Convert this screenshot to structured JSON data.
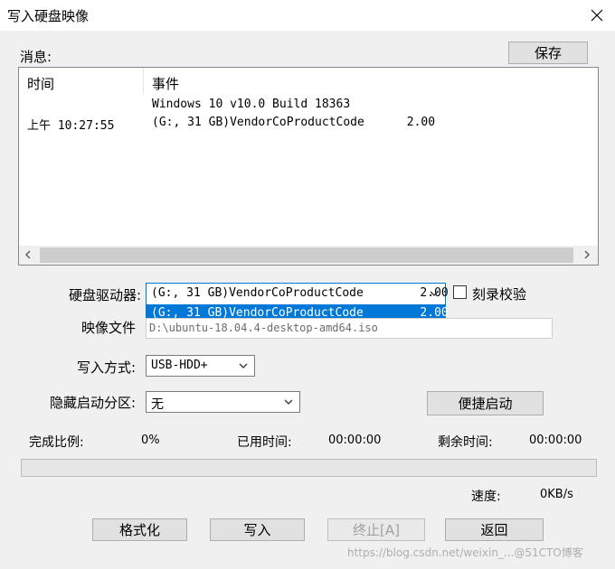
{
  "window": {
    "title": "写入硬盘映像"
  },
  "messages": {
    "label": "消息:",
    "save_label": "保存",
    "col_time": "时间",
    "col_event": "事件",
    "rows": [
      {
        "time": "",
        "event": "Windows 10 v10.0 Build 18363"
      },
      {
        "time": "上午 10:27:55",
        "event": "(G:, 31 GB)VendorCoProductCode      2.00"
      }
    ]
  },
  "drive": {
    "label": "硬盘驱动器:",
    "selected": "(G:, 31 GB)VendorCoProductCode        2.00",
    "dropdown_option": "(G:, 31 GB)VendorCoProductCode        2.00",
    "verify_label": "刻录校验",
    "verify_checked": false
  },
  "image_file": {
    "label": "映像文件",
    "value": "D:\\ubuntu-18.04.4-desktop-amd64.iso"
  },
  "write_method": {
    "label": "写入方式:",
    "selected": "USB-HDD+"
  },
  "hidden_partition": {
    "label": "隐藏启动分区:",
    "selected": "无"
  },
  "quick_boot_label": "便捷启动",
  "status": {
    "progress_label": "完成比例:",
    "progress_value": "0%",
    "progress_fraction": 0,
    "elapsed_label": "已用时间:",
    "elapsed_value": "00:00:00",
    "remaining_label": "剩余时间:",
    "remaining_value": "00:00:00",
    "speed_label": "速度:",
    "speed_value": "0KB/s"
  },
  "buttons": {
    "format": "格式化",
    "write": "写入",
    "abort": "终止[A]",
    "back": "返回"
  },
  "watermark": "https://blog.csdn.net/weixin_...@51CTO博客"
}
